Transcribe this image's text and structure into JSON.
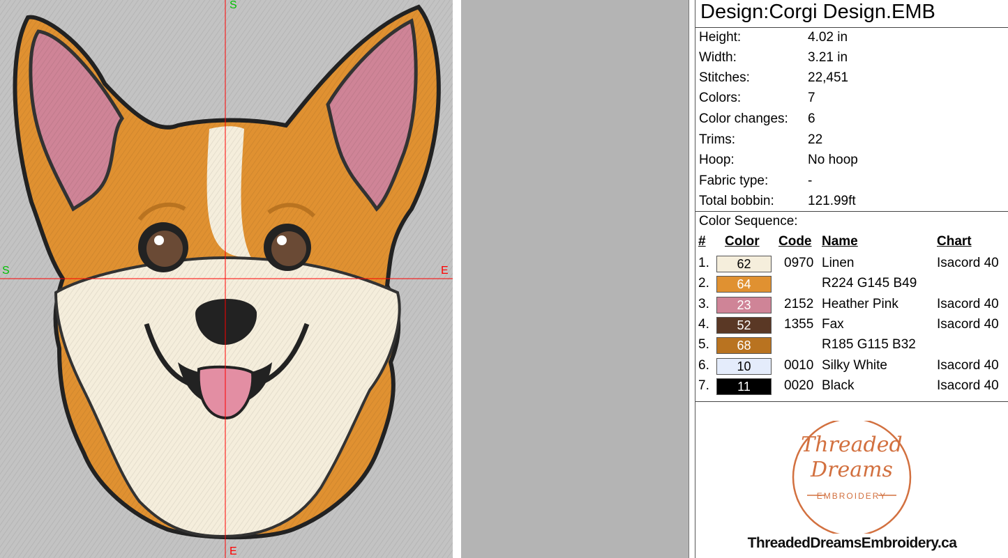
{
  "design_title": "Design:Corgi Design.EMB",
  "axis_labels": {
    "top": "S",
    "bottom": "E",
    "left": "S",
    "right": "E"
  },
  "properties": [
    {
      "label": "Height:",
      "value": "4.02 in"
    },
    {
      "label": "Width:",
      "value": "3.21 in"
    },
    {
      "label": "Stitches:",
      "value": "22,451"
    },
    {
      "label": "Colors:",
      "value": "7"
    },
    {
      "label": "Color changes:",
      "value": "6"
    },
    {
      "label": "Trims:",
      "value": "22"
    },
    {
      "label": "Hoop:",
      "value": "No hoop"
    },
    {
      "label": "Fabric type:",
      "value": "-"
    },
    {
      "label": "Total bobbin:",
      "value": "121.99ft"
    }
  ],
  "color_sequence": {
    "title": "Color Sequence:",
    "headers": {
      "num": "#",
      "color": "Color",
      "code": "Code",
      "name": "Name",
      "chart": "Chart"
    },
    "rows": [
      {
        "num": "1.",
        "swatch": "62",
        "hex": "#f5eedc",
        "text": "#000000",
        "code": "0970",
        "name": "Linen",
        "chart": "Isacord 40"
      },
      {
        "num": "2.",
        "swatch": "64",
        "hex": "#e09131",
        "text": "#ffffff",
        "code": "",
        "name": "R224 G145 B49",
        "chart": ""
      },
      {
        "num": "3.",
        "swatch": "23",
        "hex": "#cf8497",
        "text": "#ffffff",
        "code": "2152",
        "name": "Heather Pink",
        "chart": "Isacord 40"
      },
      {
        "num": "4.",
        "swatch": "52",
        "hex": "#5a3825",
        "text": "#ffffff",
        "code": "1355",
        "name": "Fax",
        "chart": "Isacord 40"
      },
      {
        "num": "5.",
        "swatch": "68",
        "hex": "#b97320",
        "text": "#ffffff",
        "code": "",
        "name": "R185 G115 B32",
        "chart": ""
      },
      {
        "num": "6.",
        "swatch": "10",
        "hex": "#e4ecfb",
        "text": "#000000",
        "code": "0010",
        "name": "Silky White",
        "chart": "Isacord 40"
      },
      {
        "num": "7.",
        "swatch": "11",
        "hex": "#000000",
        "text": "#ffffff",
        "code": "0020",
        "name": "Black",
        "chart": "Isacord 40"
      }
    ]
  },
  "logo": {
    "line1": "Threaded",
    "line2": "Dreams",
    "line3": "EMBROIDERY",
    "color": "#d2703f"
  },
  "website": "ThreadedDreamsEmbroidery.ca"
}
